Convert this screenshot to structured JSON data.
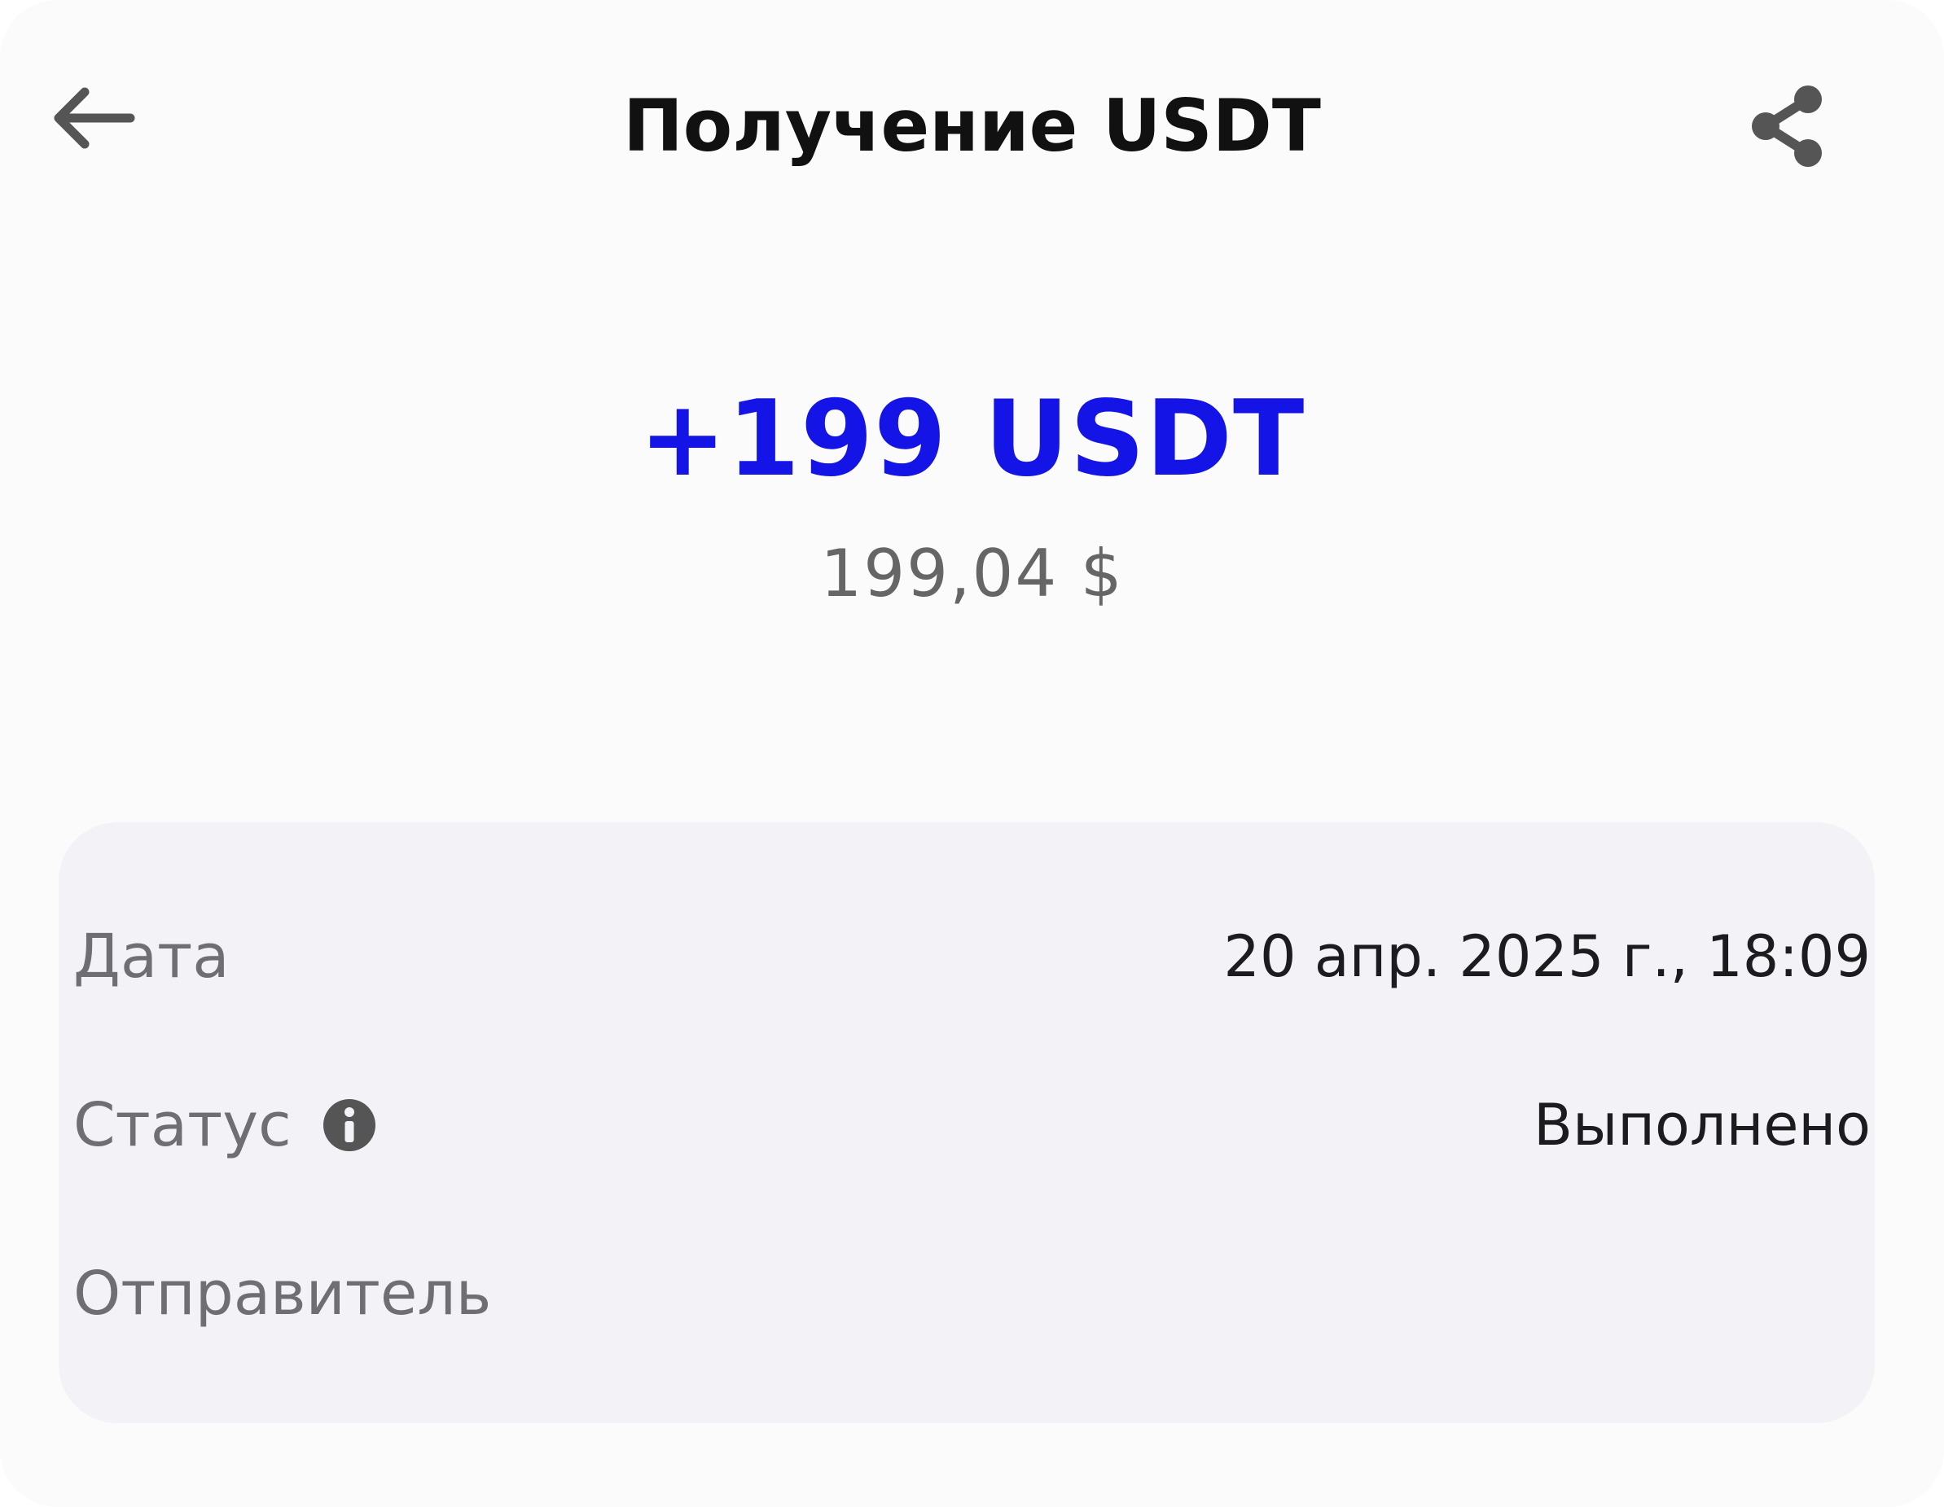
{
  "header": {
    "back_icon": "arrow-left-icon",
    "title": "Получение USDT",
    "share_icon": "share-icon"
  },
  "amount": {
    "crypto": "+199 USDT",
    "fiat": "199,04 $",
    "accent_color": "#1414e6"
  },
  "details": {
    "date": {
      "label": "Дата",
      "value": "20 апр. 2025 г., 18:09"
    },
    "status": {
      "label": "Статус",
      "info_icon": "info-icon",
      "value": "Выполнено"
    },
    "sender": {
      "label": "Отправитель",
      "value": ""
    }
  }
}
